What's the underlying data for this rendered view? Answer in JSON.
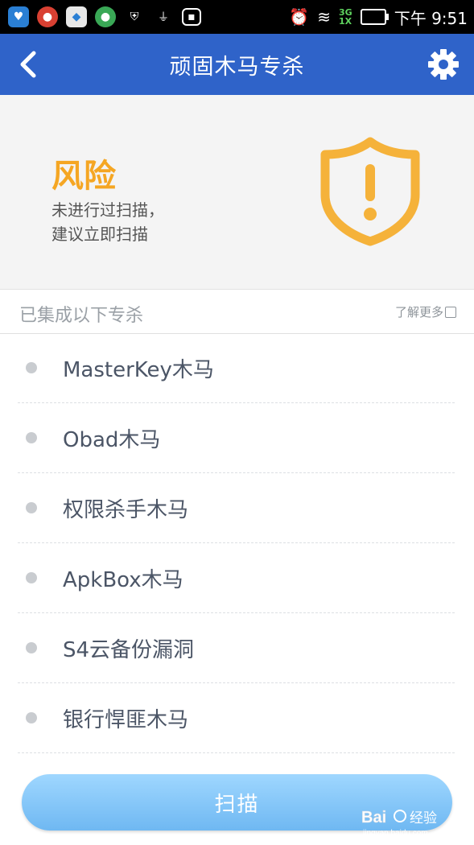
{
  "status_bar": {
    "time_prefix": "下午",
    "time": "9:51",
    "network_top": "3G",
    "network_bottom": "1X"
  },
  "header": {
    "title": "顽固木马专杀"
  },
  "risk_panel": {
    "status": "风险",
    "desc_line1": "未进行过扫描，",
    "desc_line2": "建议立即扫描",
    "accent_color": "#f5a623"
  },
  "section": {
    "label": "已集成以下专杀",
    "learn_more": "了解更多"
  },
  "list": {
    "items": [
      {
        "label": "MasterKey木马"
      },
      {
        "label": "Obad木马"
      },
      {
        "label": "权限杀手木马"
      },
      {
        "label": "ApkBox木马"
      },
      {
        "label": "S4云备份漏洞"
      },
      {
        "label": "银行悍匪木马"
      }
    ]
  },
  "scan_button": {
    "label": "扫描"
  },
  "watermark": {
    "brand": "Bai",
    "brand_cn": "经验",
    "url": "jingyan.baidu.com"
  },
  "colors": {
    "header_bg": "#2f63c9",
    "shield": "#f5b23a",
    "button": "#7fc2f7"
  }
}
